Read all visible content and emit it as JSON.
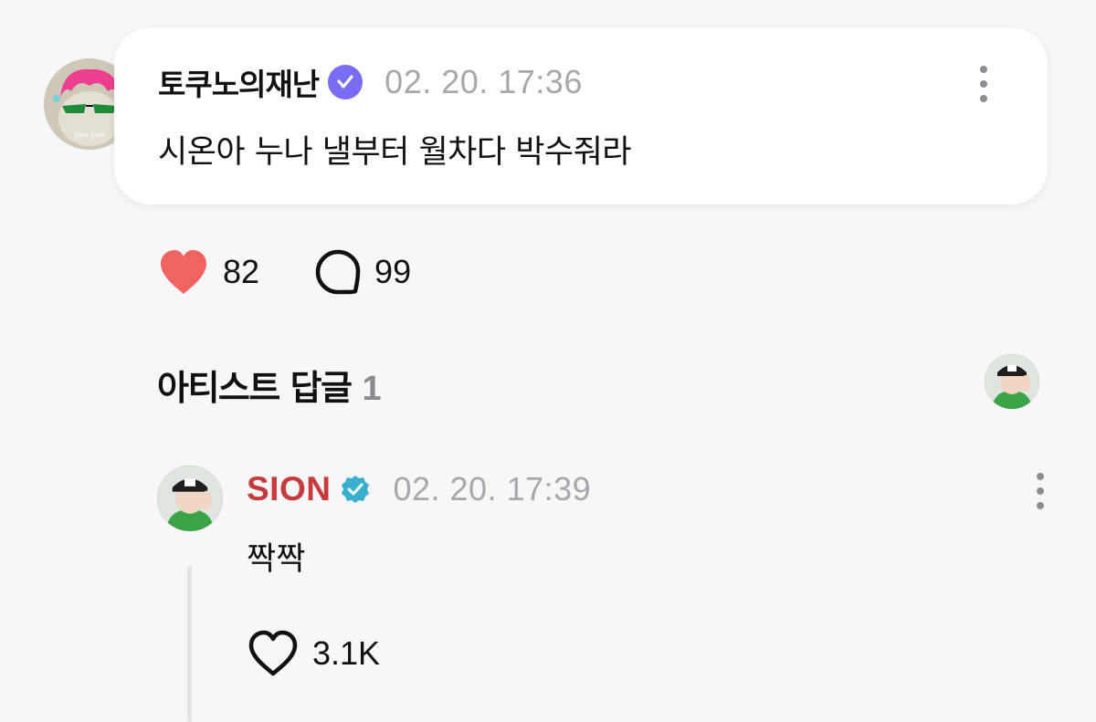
{
  "post": {
    "author": "토쿠노의재난",
    "timestamp": "02. 20. 17:36",
    "text": "시온아 누나 낼부터 월차다 박수줘라",
    "avatar_caption": "yare yare",
    "verified_badge_color": "#7b6cf6",
    "likes": "82",
    "comments": "99",
    "like_icon": "heart-filled-icon",
    "comment_icon": "speech-bubble-icon",
    "more_icon": "more-vertical-icon"
  },
  "artist_section": {
    "label": "아티스트 답글",
    "count": "1"
  },
  "reply": {
    "author": "SION",
    "author_color": "#c63b3b",
    "timestamp": "02. 20. 17:39",
    "text": "짝짝",
    "likes": "3.1K",
    "badge_icon": "verified-badge-icon",
    "badge_color": "#3ab0d0",
    "like_icon": "heart-outline-icon"
  },
  "colors": {
    "background": "#f7f7f9",
    "card": "#ffffff",
    "heart": "#ef6461",
    "muted_text": "#a7a7ae"
  }
}
